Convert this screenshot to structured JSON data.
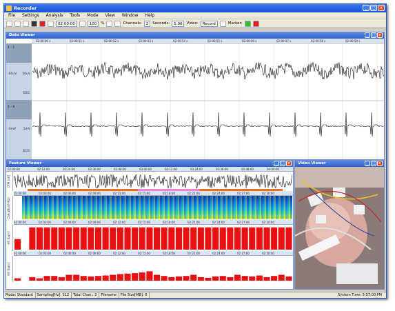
{
  "window": {
    "title": "Recorder"
  },
  "menu": [
    "File",
    "Settings",
    "Analysis",
    "Tools",
    "Mode",
    "View",
    "Window",
    "Help"
  ],
  "toolbar": {
    "time": "02:00:00",
    "zoom": "100",
    "zoom_unit": "%",
    "channels_label": "Channels:",
    "channels_value": "2",
    "seconds_label": "Seconds:",
    "seconds_value": "5.00",
    "video_label": "Video:",
    "video_value": "Record",
    "marker_label": "Marker:",
    "marker_green": "#30b030",
    "marker_red": "#e02020"
  },
  "data_viewer": {
    "title": "Data Viewer",
    "time_ticks": [
      "02:00:00 s",
      "02:00:51 s",
      "02:00:52 s",
      "02:00:53 s",
      "02:00:54 s",
      "02:00:55 s",
      "02:00:56 s",
      "02:00:57 s",
      "02:00:58 s",
      "02:00:59 s"
    ],
    "channels": [
      {
        "num": "1 - 1",
        "unit_left": "-50uV",
        "unit_right": "50uV",
        "name": "EEG"
      },
      {
        "num": "1 - 8",
        "unit_left": "-1mV",
        "unit_right": "1mV",
        "name": "ECG"
      }
    ]
  },
  "feature_viewer": {
    "title": "Feature Viewer",
    "time_ticks": [
      "02:00:00",
      "02:12:00",
      "02:24:00",
      "02:36:00",
      "02:48:00",
      "03:00:00",
      "03:12:00",
      "03:24:00",
      "03:36:00",
      "03:48:00",
      "04:00:00"
    ],
    "mid_ticks": [
      "02:00:00",
      "02:03:00",
      "02:06:00",
      "02:09:00",
      "02:12:00",
      "02:15:00",
      "02:18:00",
      "02:21:00",
      "02:24:00",
      "02:27:00",
      "02:30:00"
    ],
    "rows": [
      {
        "label": "CFM [uV]",
        "ticks": [
          "50",
          "25",
          "10",
          "5"
        ]
      },
      {
        "label": "CSA dB[uV²/Hz]",
        "ticks": [
          "20",
          "10"
        ]
      },
      {
        "label": "HR [bpm]",
        "ticks": [
          "200",
          "150",
          "100",
          "50"
        ]
      },
      {
        "label": "HR [bpm]",
        "ticks": [
          "20",
          "10"
        ]
      }
    ],
    "hr_values": [
      45,
      0,
      95,
      95,
      95,
      95,
      95,
      95,
      95,
      95,
      95,
      95,
      95,
      95,
      95,
      95,
      95,
      95,
      95,
      95,
      95,
      95,
      95,
      95,
      95,
      95,
      95,
      95,
      95,
      95,
      95,
      95,
      95,
      95,
      95,
      95,
      95,
      95
    ],
    "low_values": [
      10,
      0,
      15,
      10,
      20,
      20,
      15,
      25,
      25,
      20,
      18,
      20,
      22,
      25,
      28,
      30,
      32,
      35,
      40,
      25,
      20,
      15,
      18,
      20,
      25,
      15,
      12,
      18,
      20,
      15,
      25,
      20,
      18,
      22,
      15,
      20,
      25,
      18
    ]
  },
  "video_viewer": {
    "title": "Video Viewer"
  },
  "statusbar": {
    "mode": "Mode: Standard",
    "sampling": "Sampling[Hz]: 512",
    "channels": "Total Chan.: 2",
    "filename": "Filename",
    "filesize": "File Size[MB]: 0",
    "system_time": "System Time: 5:57:00 PM"
  }
}
